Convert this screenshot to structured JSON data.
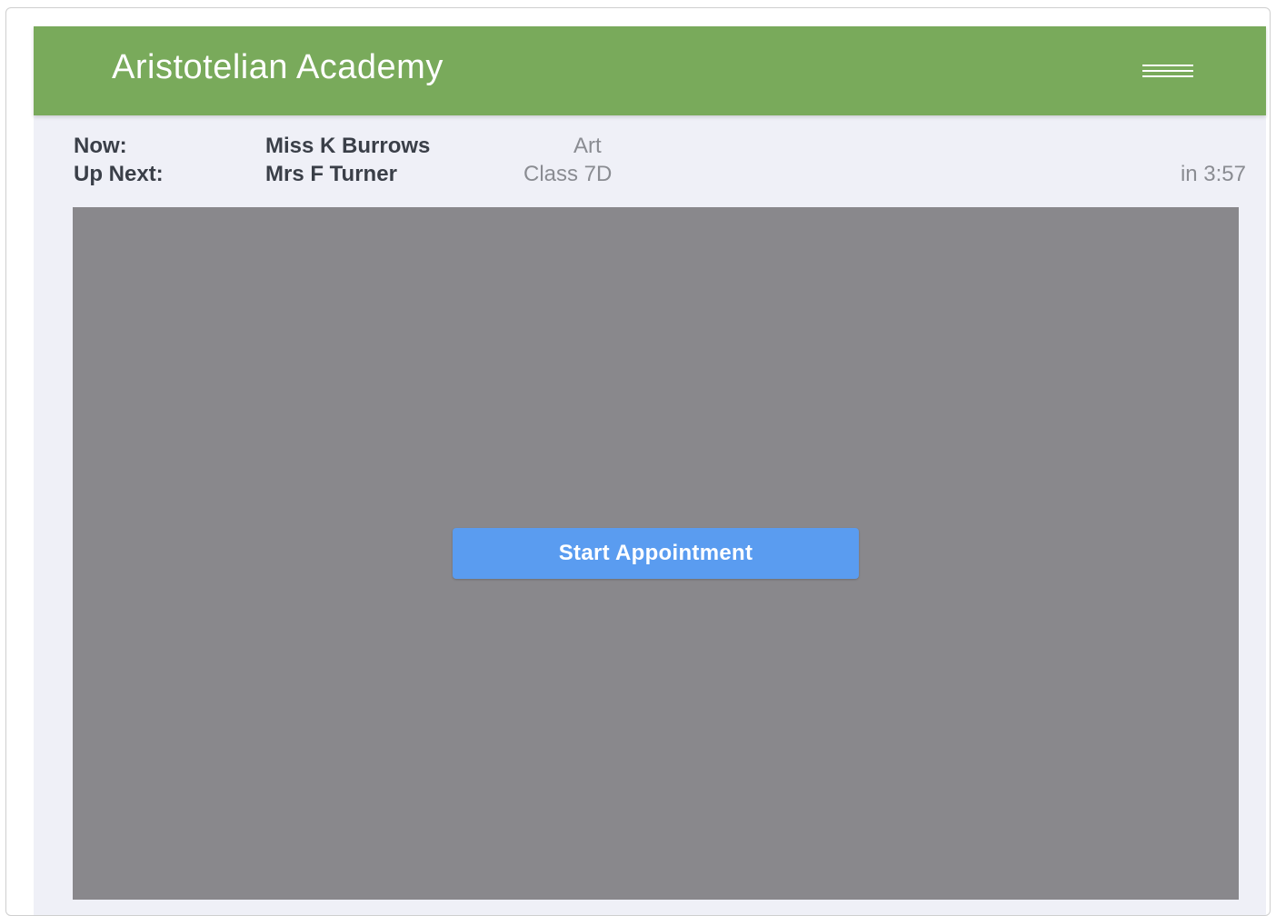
{
  "header": {
    "title": "Aristotelian Academy",
    "menu_icon": "hamburger-menu-icon"
  },
  "now": {
    "label": "Now:",
    "teacher": "Miss K Burrows",
    "subject": "Art"
  },
  "up_next": {
    "label": "Up Next:",
    "teacher": "Mrs F Turner",
    "class": "Class 7D",
    "countdown": "in 3:57"
  },
  "video": {
    "start_button_label": "Start Appointment"
  },
  "colors": {
    "header_bg": "#79aa5b",
    "page_bg": "#eff0f7",
    "video_bg": "#89888c",
    "button_bg": "#5a9cf0"
  }
}
